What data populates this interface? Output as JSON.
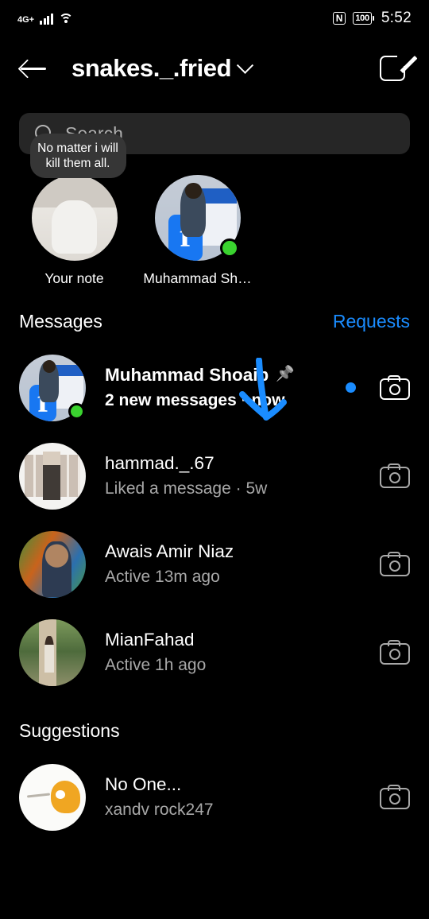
{
  "status_bar": {
    "network": "4G+",
    "nfc": "N",
    "battery": "100",
    "time": "5:52"
  },
  "header": {
    "back_icon": "back-arrow-icon",
    "title": "snakes._.fried",
    "chevron_icon": "chevron-down-icon",
    "compose_icon": "compose-icon"
  },
  "search": {
    "icon": "search-icon",
    "placeholder": "Search",
    "value": ""
  },
  "notes": [
    {
      "label": "Your note",
      "note_text": "No matter i will kill them all.",
      "has_note": true,
      "online": false
    },
    {
      "label": "Muhammad Sh…",
      "note_text": "",
      "has_note": false,
      "online": true
    }
  ],
  "messages_section": {
    "title": "Messages",
    "action": "Requests",
    "action_color": "#1a8cff"
  },
  "threads": [
    {
      "name": "Muhammad Shoaib",
      "preview": "2 new messages",
      "separator": "·",
      "time": "now",
      "unread": true,
      "pinned": true,
      "online": true,
      "camera_icon": "camera-icon"
    },
    {
      "name": "hammad._.67",
      "preview": "Liked a message",
      "separator": "·",
      "time": "5w",
      "unread": false,
      "pinned": false,
      "online": false,
      "camera_icon": "camera-icon"
    },
    {
      "name": "Awais Amir Niaz",
      "preview": "Active 13m ago",
      "separator": "",
      "time": "",
      "unread": false,
      "pinned": false,
      "online": false,
      "camera_icon": "camera-icon"
    },
    {
      "name": "MianFahad",
      "preview": "Active 1h ago",
      "separator": "",
      "time": "",
      "unread": false,
      "pinned": false,
      "online": false,
      "camera_icon": "camera-icon"
    }
  ],
  "suggestions_section": {
    "title": "Suggestions"
  },
  "suggestions": [
    {
      "name": "No One...",
      "username": "xandv rock247",
      "camera_icon": "camera-icon"
    }
  ],
  "annotation": {
    "arrow_color": "#1a8cff",
    "arrow_icon": "down-arrow-annotation"
  }
}
